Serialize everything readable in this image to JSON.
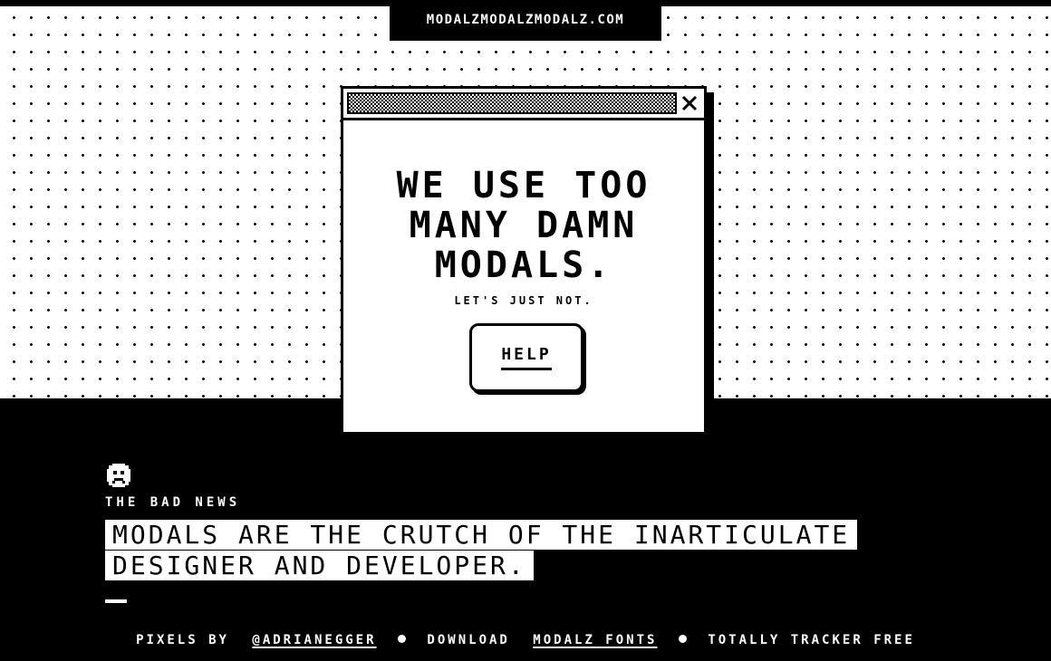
{
  "header": {
    "site_name": "MODALZMODALZMODALZ.COM"
  },
  "modal": {
    "title_lines": [
      "WE USE TOO",
      "MANY DAMN",
      "MODALS."
    ],
    "subtitle": "LET'S JUST NOT.",
    "help_label": "HELP",
    "close_icon": "close-icon"
  },
  "section": {
    "icon": "sad-face-icon",
    "label": "THE BAD NEWS",
    "quote": "MODALS ARE THE CRUTCH OF THE INARTICULATE DESIGNER AND DEVELOPER."
  },
  "footer": {
    "pixels_by": "PIXELS BY",
    "author_link": "@ADRIANEGGER",
    "download": "DOWNLOAD",
    "fonts_link": "MODALZ FONTS",
    "tracker": "TOTALLY TRACKER FREE"
  },
  "colors": {
    "background": "#000000",
    "foreground": "#ffffff"
  }
}
